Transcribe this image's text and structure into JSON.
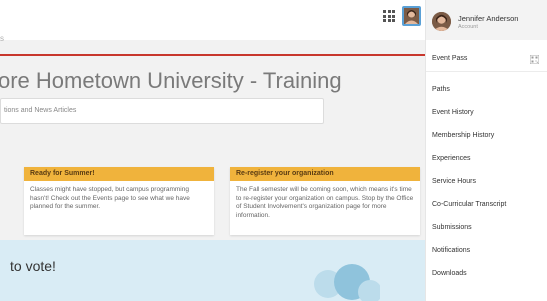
{
  "topbar": {
    "left_fragment": "s"
  },
  "main": {
    "title": "ore Hometown University - Training",
    "search_placeholder": "tions and News Articles",
    "cards": [
      {
        "heading": "Ready for Summer!",
        "body": "Classes might have stopped, but campus programming hasn't! Check out the Events page to see what we have planned for the summer."
      },
      {
        "heading": "Re-register your organization",
        "body": "The Fall semester will be coming soon, which means it's time to re-register your organization on campus. Stop by the Office of Student Involvement's organization page for more information."
      }
    ],
    "vote_text": "to vote!"
  },
  "account_menu": {
    "user_name": "Jennifer Anderson",
    "user_sub": "Account",
    "event_pass": "Event Pass",
    "items": [
      "Paths",
      "Event History",
      "Membership History",
      "Experiences",
      "Service Hours",
      "Co-Curricular Transcript",
      "Submissions",
      "Notifications",
      "Downloads"
    ]
  },
  "colors": {
    "accent_red": "#c8372d",
    "card_header": "#f0b33c",
    "avatar_border": "#5aa0d6"
  },
  "icons": {
    "grid": "apps-grid-icon",
    "qr": "qr-code-icon",
    "avatar": "user-avatar"
  }
}
